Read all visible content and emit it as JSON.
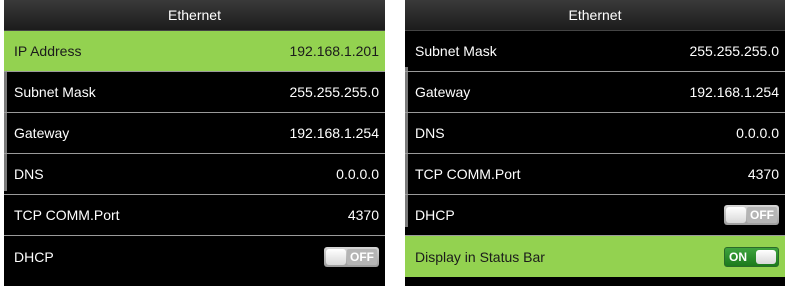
{
  "left_screen": {
    "title": "Ethernet",
    "items": [
      {
        "label": "IP Address",
        "value": "192.168.1.201"
      },
      {
        "label": "Subnet Mask",
        "value": "255.255.255.0"
      },
      {
        "label": "Gateway",
        "value": "192.168.1.254"
      },
      {
        "label": "DNS",
        "value": "0.0.0.0"
      },
      {
        "label": "TCP COMM.Port",
        "value": "4370"
      },
      {
        "label": "DHCP",
        "toggle": "OFF"
      }
    ],
    "selected_item": "IP Address"
  },
  "right_screen": {
    "title": "Ethernet",
    "items": [
      {
        "label": "Subnet Mask",
        "value": "255.255.255.0"
      },
      {
        "label": "Gateway",
        "value": "192.168.1.254"
      },
      {
        "label": "DNS",
        "value": "0.0.0.0"
      },
      {
        "label": "TCP COMM.Port",
        "value": "4370"
      },
      {
        "label": "DHCP",
        "toggle": "OFF"
      },
      {
        "label": "Display in Status Bar",
        "toggle": "ON"
      }
    ],
    "selected_item": "Display in Status Bar"
  },
  "colors": {
    "selected_row": "#93d250",
    "screen_background": "#000000",
    "toggle_on": "#2a8f2a",
    "toggle_off": "#b5b5b5"
  }
}
